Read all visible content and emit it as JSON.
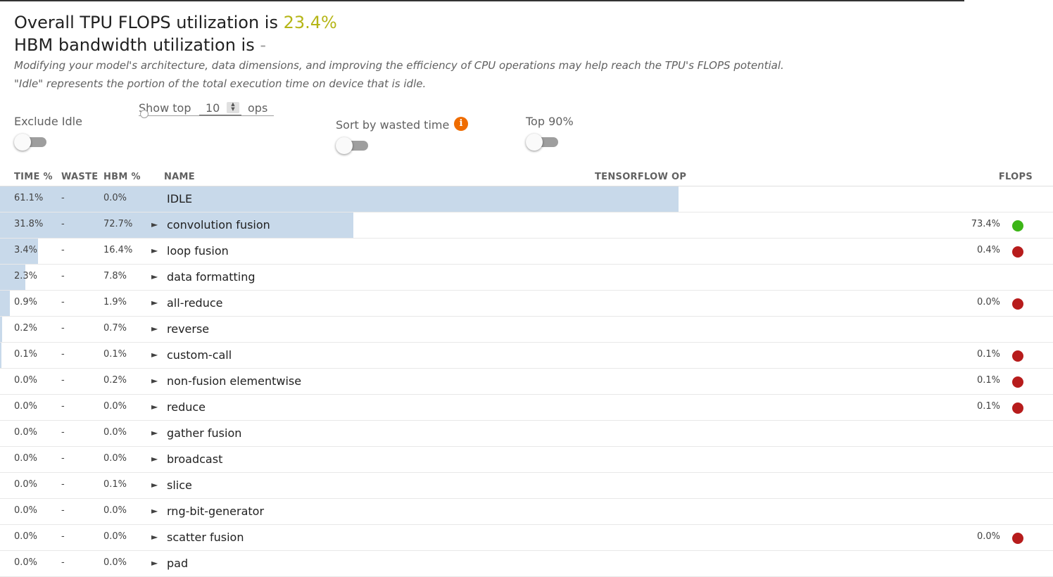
{
  "header": {
    "flops_prefix": "Overall TPU FLOPS utilization is ",
    "flops_value": "23.4%",
    "hbm_prefix": "HBM bandwidth utilization is ",
    "hbm_value": "-",
    "note1": "Modifying your model's architecture, data dimensions, and improving the efficiency of CPU operations may help reach the TPU's FLOPS potential.",
    "note2": "\"Idle\" represents the portion of the total execution time on device that is idle."
  },
  "controls": {
    "exclude_idle_label": "Exclude Idle",
    "exclude_idle_on": false,
    "show_top_label": "Show top",
    "show_top_value": "10",
    "show_top_units": "ops",
    "sort_label": "Sort by wasted time",
    "sort_on": false,
    "info_icon": "info-icon",
    "top90_label": "Top 90%",
    "top90_on": false
  },
  "table": {
    "headers": {
      "time": "TIME %",
      "waste": "WASTE",
      "hbm": "HBM %",
      "name": "NAME",
      "tf_op": "TENSORFLOW OP",
      "flops": "FLOPS"
    },
    "expand_glyph": "►",
    "rows": [
      {
        "time": "61.1%",
        "time_fraction": 0.611,
        "waste": "-",
        "hbm": "0.0%",
        "name": "IDLE",
        "expandable": false,
        "flops": "",
        "status": "none"
      },
      {
        "time": "31.8%",
        "time_fraction": 0.318,
        "waste": "-",
        "hbm": "72.7%",
        "name": "convolution fusion",
        "expandable": true,
        "flops": "73.4%",
        "status": "good"
      },
      {
        "time": "3.4%",
        "time_fraction": 0.034,
        "waste": "-",
        "hbm": "16.4%",
        "name": "loop fusion",
        "expandable": true,
        "flops": "0.4%",
        "status": "bad"
      },
      {
        "time": "2.3%",
        "time_fraction": 0.023,
        "waste": "-",
        "hbm": "7.8%",
        "name": "data formatting",
        "expandable": true,
        "flops": "",
        "status": "none"
      },
      {
        "time": "0.9%",
        "time_fraction": 0.009,
        "waste": "-",
        "hbm": "1.9%",
        "name": "all-reduce",
        "expandable": true,
        "flops": "0.0%",
        "status": "bad"
      },
      {
        "time": "0.2%",
        "time_fraction": 0.002,
        "waste": "-",
        "hbm": "0.7%",
        "name": "reverse",
        "expandable": true,
        "flops": "",
        "status": "none"
      },
      {
        "time": "0.1%",
        "time_fraction": 0.001,
        "waste": "-",
        "hbm": "0.1%",
        "name": "custom-call",
        "expandable": true,
        "flops": "0.1%",
        "status": "bad"
      },
      {
        "time": "0.0%",
        "time_fraction": 0.0,
        "waste": "-",
        "hbm": "0.2%",
        "name": "non-fusion elementwise",
        "expandable": true,
        "flops": "0.1%",
        "status": "bad"
      },
      {
        "time": "0.0%",
        "time_fraction": 0.0,
        "waste": "-",
        "hbm": "0.0%",
        "name": "reduce",
        "expandable": true,
        "flops": "0.1%",
        "status": "bad"
      },
      {
        "time": "0.0%",
        "time_fraction": 0.0,
        "waste": "-",
        "hbm": "0.0%",
        "name": "gather fusion",
        "expandable": true,
        "flops": "",
        "status": "none"
      },
      {
        "time": "0.0%",
        "time_fraction": 0.0,
        "waste": "-",
        "hbm": "0.0%",
        "name": "broadcast",
        "expandable": true,
        "flops": "",
        "status": "none"
      },
      {
        "time": "0.0%",
        "time_fraction": 0.0,
        "waste": "-",
        "hbm": "0.1%",
        "name": "slice",
        "expandable": true,
        "flops": "",
        "status": "none"
      },
      {
        "time": "0.0%",
        "time_fraction": 0.0,
        "waste": "-",
        "hbm": "0.0%",
        "name": "rng-bit-generator",
        "expandable": true,
        "flops": "",
        "status": "none"
      },
      {
        "time": "0.0%",
        "time_fraction": 0.0,
        "waste": "-",
        "hbm": "0.0%",
        "name": "scatter fusion",
        "expandable": true,
        "flops": "0.0%",
        "status": "bad"
      },
      {
        "time": "0.0%",
        "time_fraction": 0.0,
        "waste": "-",
        "hbm": "0.0%",
        "name": "pad",
        "expandable": true,
        "flops": "",
        "status": "none"
      }
    ]
  },
  "colors": {
    "good": "#3cb517",
    "bad": "#b71c1c",
    "bar": "#c8d9ea",
    "flops_value": "#b5b516"
  }
}
